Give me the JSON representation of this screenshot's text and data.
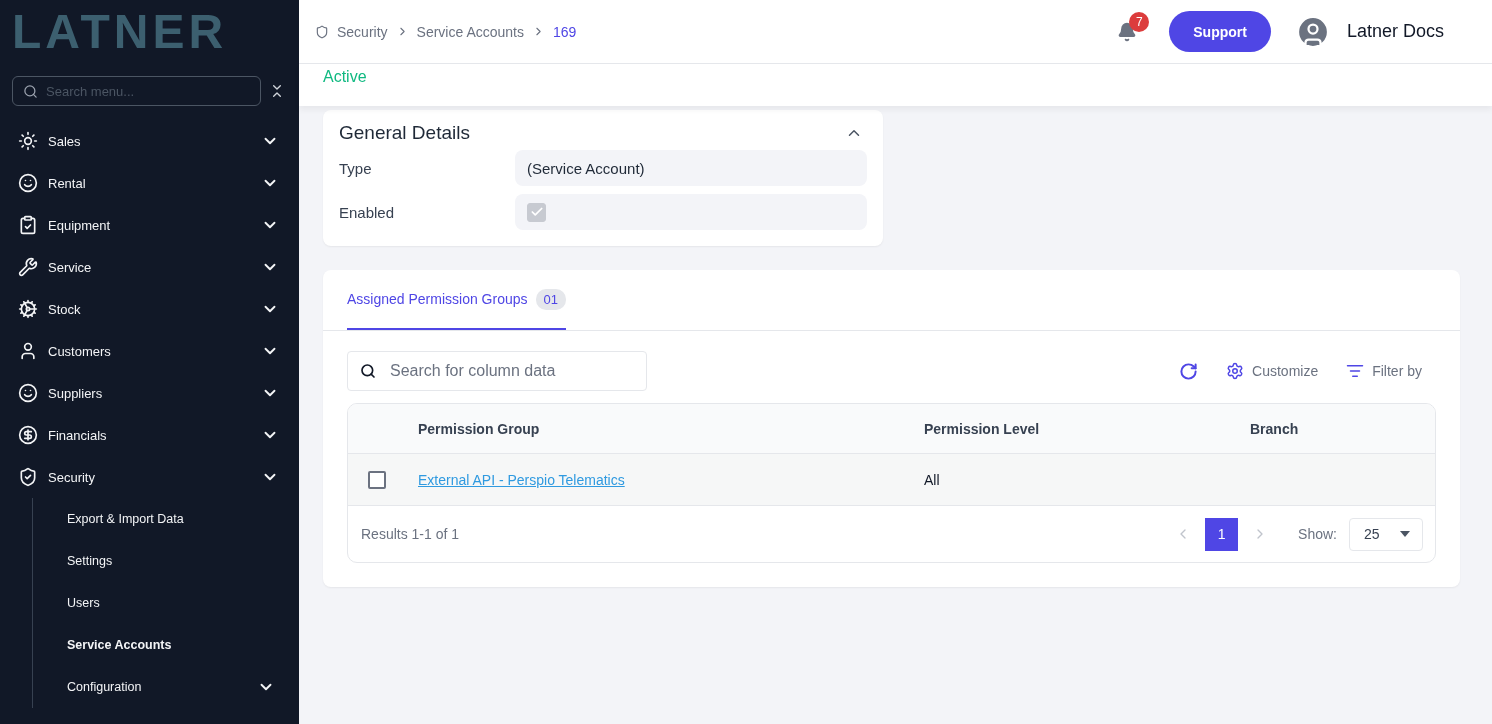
{
  "logo": {
    "text": "LATNER"
  },
  "sidebar": {
    "search": {
      "placeholder": "Search menu..."
    },
    "items": [
      {
        "label": "Sales"
      },
      {
        "label": "Rental"
      },
      {
        "label": "Equipment"
      },
      {
        "label": "Service"
      },
      {
        "label": "Stock"
      },
      {
        "label": "Customers"
      },
      {
        "label": "Suppliers"
      },
      {
        "label": "Financials"
      },
      {
        "label": "Security",
        "children": [
          {
            "label": "Export & Import Data",
            "selected": false,
            "has_children": false
          },
          {
            "label": "Settings",
            "selected": false,
            "has_children": false
          },
          {
            "label": "Users",
            "selected": false,
            "has_children": false
          },
          {
            "label": "Service Accounts",
            "selected": true,
            "has_children": false
          },
          {
            "label": "Configuration",
            "selected": false,
            "has_children": true
          }
        ]
      }
    ]
  },
  "header": {
    "breadcrumb": [
      "Security",
      "Service Accounts",
      "169"
    ],
    "notification_count": "7",
    "support_button": "Support",
    "user_name": "Latner Docs"
  },
  "status": "Active",
  "general_details": {
    "title": "General Details",
    "expanded": true,
    "fields": [
      {
        "label": "Type",
        "kind": "text",
        "value": "(Service Account)"
      },
      {
        "label": "Enabled",
        "kind": "checkbox",
        "checked": true
      }
    ]
  },
  "permissions": {
    "tabs": [
      {
        "label": "Assigned Permission Groups",
        "count": "01",
        "selected": true
      }
    ],
    "search": {
      "placeholder": "Search for column data"
    },
    "actions": [
      {
        "label": "Customize"
      },
      {
        "label": "Filter by"
      }
    ],
    "table": {
      "columns": [
        "Permission Group",
        "Permission Level",
        "Branch"
      ],
      "rows": [
        {
          "checked": false,
          "permission_group": "External API - Perspio Telematics",
          "permission_level": "All"
        }
      ]
    },
    "footer": {
      "results": "Results 1-1 of 1",
      "pages": [
        {
          "label": "1",
          "selected": true
        }
      ],
      "show_label": "Show:",
      "page_size": "25"
    }
  }
}
